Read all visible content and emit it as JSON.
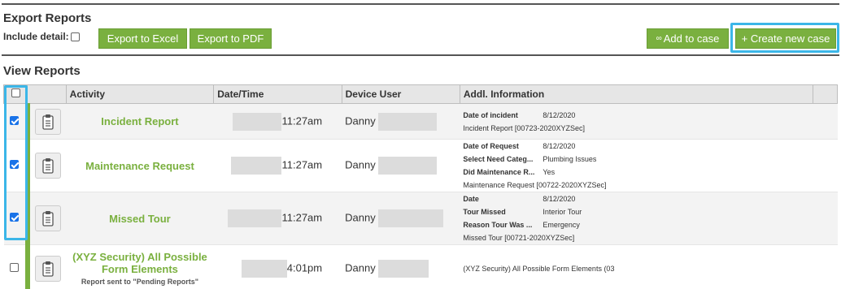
{
  "export": {
    "title": "Export Reports",
    "include_detail_label": "Include detail:",
    "excel_button": "Export to Excel",
    "pdf_button": "Export to PDF",
    "add_case_button": "Add to case",
    "create_case_button": "+ Create new case"
  },
  "view": {
    "title": "View Reports",
    "columns": [
      "Activity",
      "Date/Time",
      "Device User",
      "Addl. Information"
    ]
  },
  "rows": [
    {
      "checked": true,
      "activity": "Incident Report",
      "sub": "",
      "time": "11:27am",
      "user": "Danny",
      "info": [
        {
          "k": "Date of incident",
          "v": "8/12/2020"
        },
        {
          "k": "",
          "v": "Incident Report [00723-2020XYZSec]"
        }
      ]
    },
    {
      "checked": true,
      "activity": "Maintenance Request",
      "sub": "",
      "time": "11:27am",
      "user": "Danny",
      "info": [
        {
          "k": "Date of Request",
          "v": "8/12/2020"
        },
        {
          "k": "Select Need Categ...",
          "v": "Plumbing Issues"
        },
        {
          "k": "Did Maintenance R...",
          "v": "Yes"
        },
        {
          "k": "",
          "v": "Maintenance Request [00722-2020XYZSec]"
        }
      ]
    },
    {
      "checked": true,
      "activity": "Missed Tour",
      "sub": "",
      "time": "11:27am",
      "user": "Danny",
      "info": [
        {
          "k": "Date",
          "v": "8/12/2020"
        },
        {
          "k": "Tour Missed",
          "v": "Interior Tour"
        },
        {
          "k": "Reason Tour Was ...",
          "v": "Emergency"
        },
        {
          "k": "",
          "v": "Missed Tour [00721-2020XYZSec]"
        }
      ]
    },
    {
      "checked": false,
      "activity": "(XYZ Security) All Possible Form Elements",
      "sub": "Report sent to \"Pending Reports\"",
      "time": "4:01pm",
      "user": "Danny",
      "info": [
        {
          "k": "",
          "v": "(XYZ Security) All Possible Form Elements (03"
        }
      ]
    }
  ],
  "colors": {
    "accent": "#7ab03f",
    "highlight": "#3bb6e8"
  },
  "icons": {
    "report": "clipboard-icon",
    "add_case": "link-icon"
  }
}
